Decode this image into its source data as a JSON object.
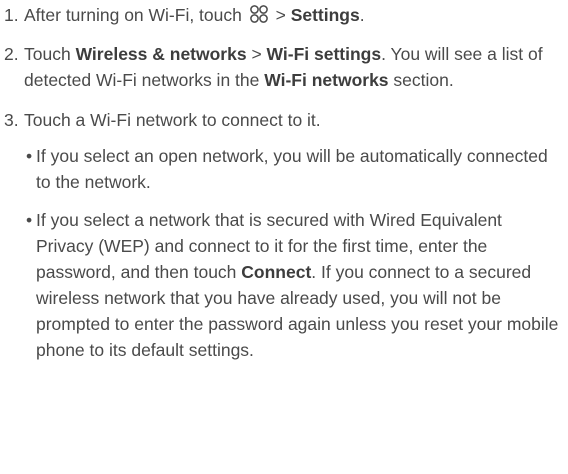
{
  "steps": [
    {
      "num": "1.",
      "pre": "After turning on Wi-Fi, touch ",
      "icon": "apps-grid-icon",
      "mid": " > ",
      "b1": "Settings",
      "post": "."
    },
    {
      "num": "2.",
      "pre": "Touch ",
      "b1": "Wireless & networks",
      "mid": " > ",
      "b2": "Wi-Fi settings",
      "mid2": ". You will see a list of detected Wi-Fi networks in the ",
      "b3": "Wi-Fi networks",
      "post": " section."
    },
    {
      "num": "3.",
      "text": "Touch a Wi-Fi network to connect to it."
    }
  ],
  "bullets": [
    {
      "dot": "•",
      "text": "If you select an open network, you will be automatically connected to the network."
    },
    {
      "dot": "•",
      "pre": "If you select a network that is secured with Wired Equivalent Privacy (WEP) and connect to it for the first time, enter the password, and then touch ",
      "b1": "Connect",
      "post": ". If you connect to a secured wireless network that you have already used, you will not be prompted to enter the password again unless you reset your mobile phone to its default settings."
    }
  ]
}
